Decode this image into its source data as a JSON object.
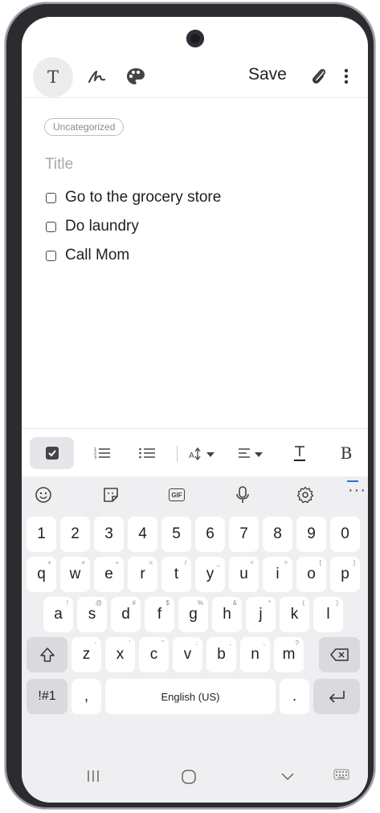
{
  "toolbar": {
    "text_mode_label": "T",
    "save_label": "Save"
  },
  "note": {
    "category_label": "Uncategorized",
    "title_placeholder": "Title",
    "checklist": [
      {
        "text": "Go to the grocery store",
        "checked": false
      },
      {
        "text": "Do laundry",
        "checked": false
      },
      {
        "text": "Call Mom",
        "checked": false
      }
    ]
  },
  "format_bar": {
    "bold_label": "B"
  },
  "keyboard": {
    "toolbar": {
      "gif_label": "GIF",
      "more_label": "···"
    },
    "row_numbers": [
      "1",
      "2",
      "3",
      "4",
      "5",
      "6",
      "7",
      "8",
      "9",
      "0"
    ],
    "row_top": [
      {
        "key": "q",
        "hint": "+"
      },
      {
        "key": "w",
        "hint": "×"
      },
      {
        "key": "e",
        "hint": "÷"
      },
      {
        "key": "r",
        "hint": "="
      },
      {
        "key": "t",
        "hint": "/"
      },
      {
        "key": "y",
        "hint": "_"
      },
      {
        "key": "u",
        "hint": "<"
      },
      {
        "key": "i",
        "hint": ">"
      },
      {
        "key": "o",
        "hint": "["
      },
      {
        "key": "p",
        "hint": "]"
      }
    ],
    "row_home": [
      {
        "key": "a",
        "hint": "!"
      },
      {
        "key": "s",
        "hint": "@"
      },
      {
        "key": "d",
        "hint": "#"
      },
      {
        "key": "f",
        "hint": "$"
      },
      {
        "key": "g",
        "hint": "%"
      },
      {
        "key": "h",
        "hint": "&"
      },
      {
        "key": "j",
        "hint": "*"
      },
      {
        "key": "k",
        "hint": "("
      },
      {
        "key": "l",
        "hint": ")"
      }
    ],
    "row_bottom": [
      {
        "key": "z",
        "hint": "-"
      },
      {
        "key": "x",
        "hint": "'"
      },
      {
        "key": "c",
        "hint": "\""
      },
      {
        "key": "v",
        "hint": ":"
      },
      {
        "key": "b",
        "hint": ";"
      },
      {
        "key": "n",
        "hint": ","
      },
      {
        "key": "m",
        "hint": "?"
      }
    ],
    "symbols_label": "!#1",
    "comma_label": ",",
    "space_label": "English (US)",
    "period_label": "."
  },
  "colors": {
    "keyboard_bg": "#efeff1",
    "callout_line": "#2f6fdb"
  }
}
